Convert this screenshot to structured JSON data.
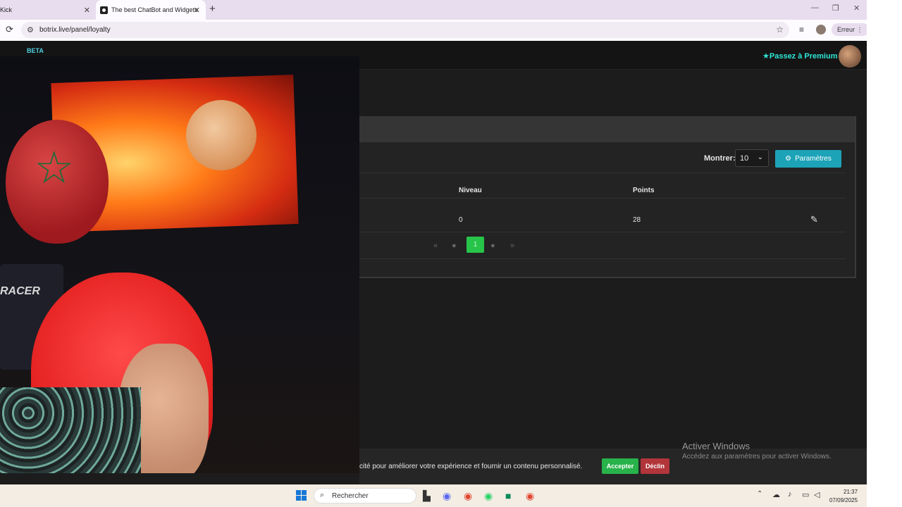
{
  "browser": {
    "tabs": [
      {
        "label": "Kick",
        "active": false
      },
      {
        "label": "The best ChatBot and Widgets",
        "active": true
      }
    ],
    "url": "botrix.live/panel/loyalty",
    "profile_button": "Erreur"
  },
  "header": {
    "badge": "BETA",
    "premium_label": "Passez à Premium"
  },
  "loyalty": {
    "show_label": "Montrer:",
    "page_size": "10",
    "settings_label": "Paramètres",
    "columns": [
      "Niveau",
      "Points"
    ],
    "rows": [
      {
        "niveau": "0",
        "points": "28"
      }
    ],
    "pagination": {
      "current": "1"
    }
  },
  "cookie_banner": {
    "text": "cité pour améliorer votre expérience et fournir un contenu personnalisé.",
    "accept": "Accepter",
    "decline": "Déclin"
  },
  "watermark": {
    "title": "Activer Windows",
    "subtitle": "Accédez aux paramètres pour activer Windows."
  },
  "overlay": {
    "chair_text": "RACER"
  },
  "taskbar": {
    "search_placeholder": "Rechercher",
    "time": "21:37",
    "date": "07/09/2025"
  },
  "colors": {
    "accent": "#2ee6d6",
    "settings_button": "#1da3b8",
    "accept": "#28b34a",
    "decline": "#b2353a",
    "page_active": "#27c44a"
  }
}
